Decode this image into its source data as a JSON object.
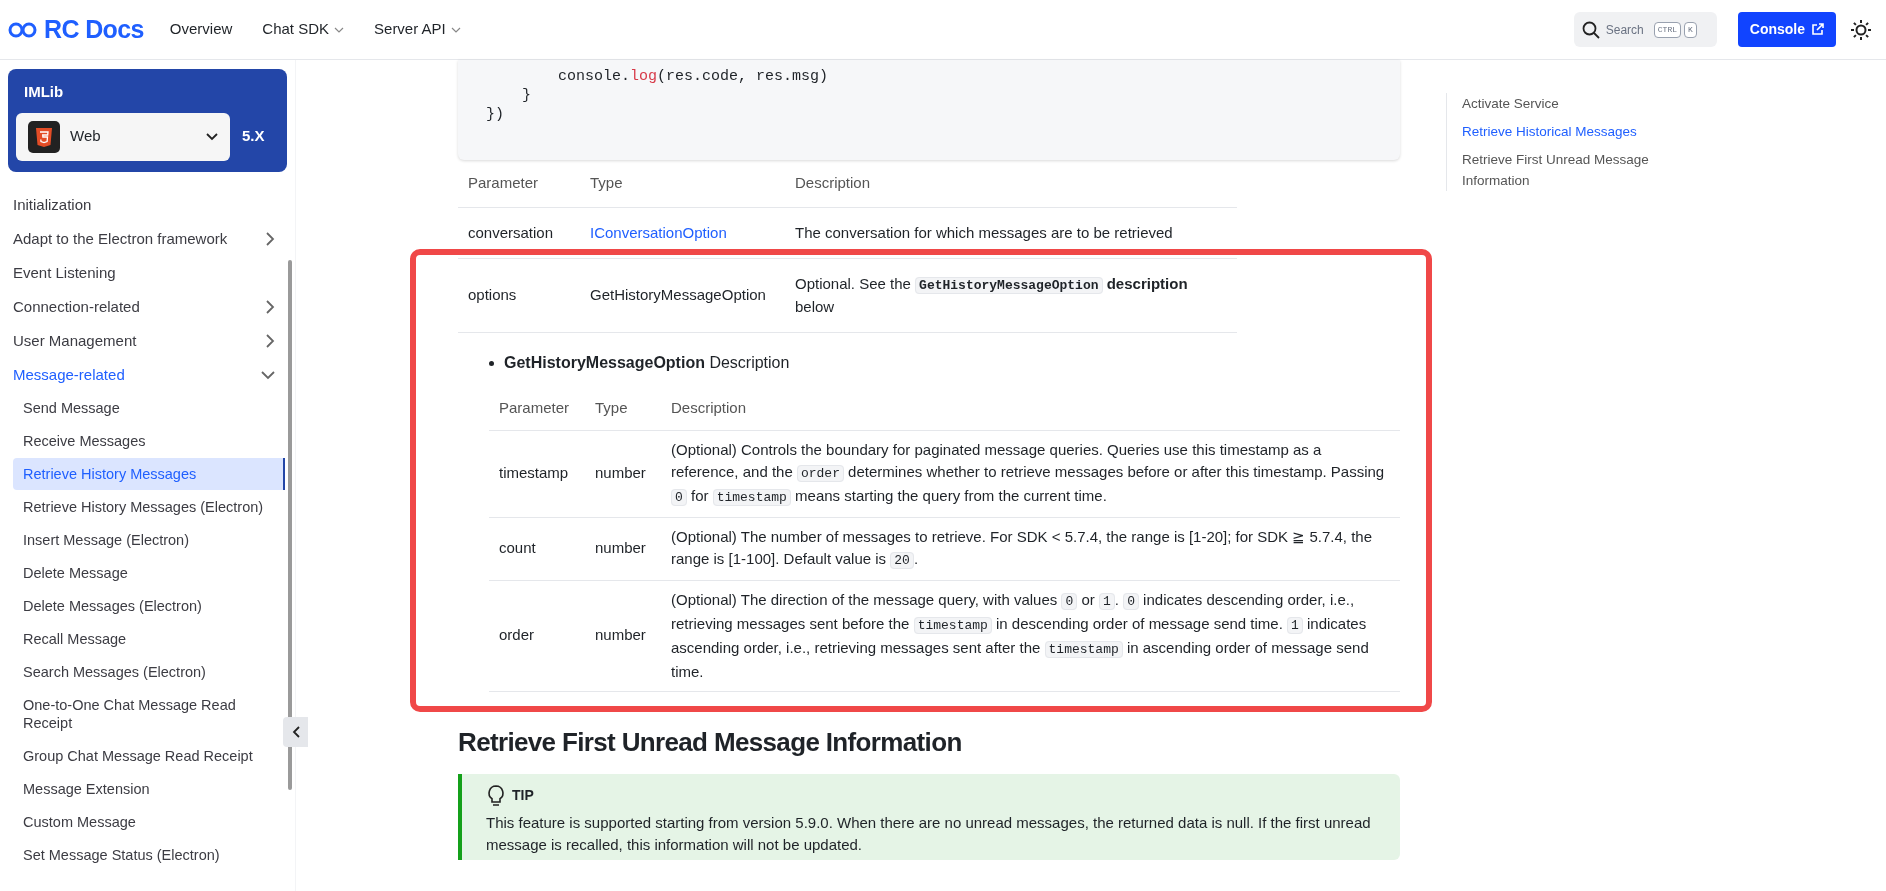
{
  "header": {
    "logo": "RC Docs",
    "nav": [
      {
        "label": "Overview",
        "dropdown": false
      },
      {
        "label": "Chat SDK",
        "dropdown": true
      },
      {
        "label": "Server API",
        "dropdown": true
      }
    ],
    "search": {
      "placeholder": "Search",
      "keys": [
        "CTRL",
        "K"
      ]
    },
    "console_button": "Console"
  },
  "sidebar": {
    "product": "IMLib",
    "platform": "Web",
    "version": "5.X",
    "items": [
      {
        "label": "Initialization",
        "kind": "link",
        "expanded": false
      },
      {
        "label": "Adapt to the Electron framework",
        "kind": "group",
        "expanded": false
      },
      {
        "label": "Event Listening",
        "kind": "link",
        "expanded": false
      },
      {
        "label": "Connection-related",
        "kind": "group",
        "expanded": false
      },
      {
        "label": "User Management",
        "kind": "group",
        "expanded": false
      },
      {
        "label": "Message-related",
        "kind": "group",
        "expanded": true,
        "children": [
          {
            "label": "Send Message",
            "selected": false
          },
          {
            "label": "Receive Messages",
            "selected": false
          },
          {
            "label": "Retrieve History Messages",
            "selected": true
          },
          {
            "label": "Retrieve History Messages (Electron)",
            "selected": false
          },
          {
            "label": "Insert Message (Electron)",
            "selected": false
          },
          {
            "label": "Delete Message",
            "selected": false
          },
          {
            "label": "Delete Messages (Electron)",
            "selected": false
          },
          {
            "label": "Recall Message",
            "selected": false
          },
          {
            "label": "Search Messages (Electron)",
            "selected": false
          },
          {
            "label": "One-to-One Chat Message Read Receipt",
            "selected": false
          },
          {
            "label": "Group Chat Message Read Receipt",
            "selected": false
          },
          {
            "label": "Message Extension",
            "selected": false
          },
          {
            "label": "Custom Message",
            "selected": false
          },
          {
            "label": "Set Message Status (Electron)",
            "selected": false
          }
        ]
      }
    ]
  },
  "code_block": {
    "lines": [
      [
        {
          "kind": "plain",
          "text": "        console."
        },
        {
          "kind": "fn",
          "text": "log"
        },
        {
          "kind": "plain",
          "text": "(res.code, res.msg)"
        }
      ],
      [
        {
          "kind": "plain",
          "text": "    }"
        }
      ],
      [
        {
          "kind": "plain",
          "text": "})"
        }
      ]
    ]
  },
  "params_table": {
    "columns": [
      "Parameter",
      "Type",
      "Description"
    ],
    "rows": [
      {
        "parameter": "conversation",
        "type": "IConversationOption",
        "type_link": true,
        "description": [
          {
            "kind": "text",
            "text": "The conversation for which messages are to be retrieved"
          }
        ]
      },
      {
        "parameter": "options",
        "type": "GetHistoryMessageOption",
        "type_link": false,
        "description": [
          {
            "kind": "text",
            "text": "Optional. See the "
          },
          {
            "kind": "code_bold",
            "text": "GetHistoryMessageOption"
          },
          {
            "kind": "bold",
            "text": " description"
          },
          {
            "kind": "text",
            "text": " below"
          }
        ]
      }
    ]
  },
  "option_section": {
    "bullet": "**GetHistoryMessageOption** Description",
    "columns": [
      "Parameter",
      "Type",
      "Description"
    ],
    "rows": [
      {
        "parameter": "timestamp",
        "type": "number",
        "description": [
          {
            "kind": "text",
            "text": "(Optional) Controls the boundary for paginated message queries. Queries use this timestamp as a reference, and the "
          },
          {
            "kind": "code",
            "text": "order"
          },
          {
            "kind": "text",
            "text": " determines whether to retrieve messages before or after this timestamp. Passing "
          },
          {
            "kind": "code",
            "text": "0"
          },
          {
            "kind": "text",
            "text": " for "
          },
          {
            "kind": "code",
            "text": "timestamp"
          },
          {
            "kind": "text",
            "text": " means starting the query from the current time."
          }
        ]
      },
      {
        "parameter": "count",
        "type": "number",
        "description": [
          {
            "kind": "text",
            "text": "(Optional) The number of messages to retrieve. For SDK < 5.7.4, the range is [1-20]; for SDK ≧ 5.7.4, the range is [1-100]. Default value is "
          },
          {
            "kind": "code",
            "text": "20"
          },
          {
            "kind": "text",
            "text": "."
          }
        ]
      },
      {
        "parameter": "order",
        "type": "number",
        "description": [
          {
            "kind": "text",
            "text": "(Optional) The direction of the message query, with values "
          },
          {
            "kind": "code",
            "text": "0"
          },
          {
            "kind": "text",
            "text": " or "
          },
          {
            "kind": "code",
            "text": "1"
          },
          {
            "kind": "text",
            "text": ". "
          },
          {
            "kind": "code",
            "text": "0"
          },
          {
            "kind": "text",
            "text": " indicates descending order, i.e., retrieving messages sent before the "
          },
          {
            "kind": "code",
            "text": "timestamp"
          },
          {
            "kind": "text",
            "text": " in descending order of message send time. "
          },
          {
            "kind": "code",
            "text": "1"
          },
          {
            "kind": "text",
            "text": " indicates ascending order, i.e., retrieving messages sent after the "
          },
          {
            "kind": "code",
            "text": "timestamp"
          },
          {
            "kind": "text",
            "text": " in ascending order of message send time."
          }
        ]
      }
    ]
  },
  "next_section": {
    "heading": "Retrieve First Unread Message Information",
    "tip": {
      "label": "TIP",
      "text": "This feature is supported starting from version 5.9.0. When there are no unread messages, the returned data is null. If the first unread message is recalled, this information will not be updated."
    }
  },
  "toc": [
    {
      "label": "Activate Service",
      "selected": false
    },
    {
      "label": "Retrieve Historical Messages",
      "selected": true
    },
    {
      "label": "Retrieve First Unread Message Information",
      "selected": false
    }
  ]
}
